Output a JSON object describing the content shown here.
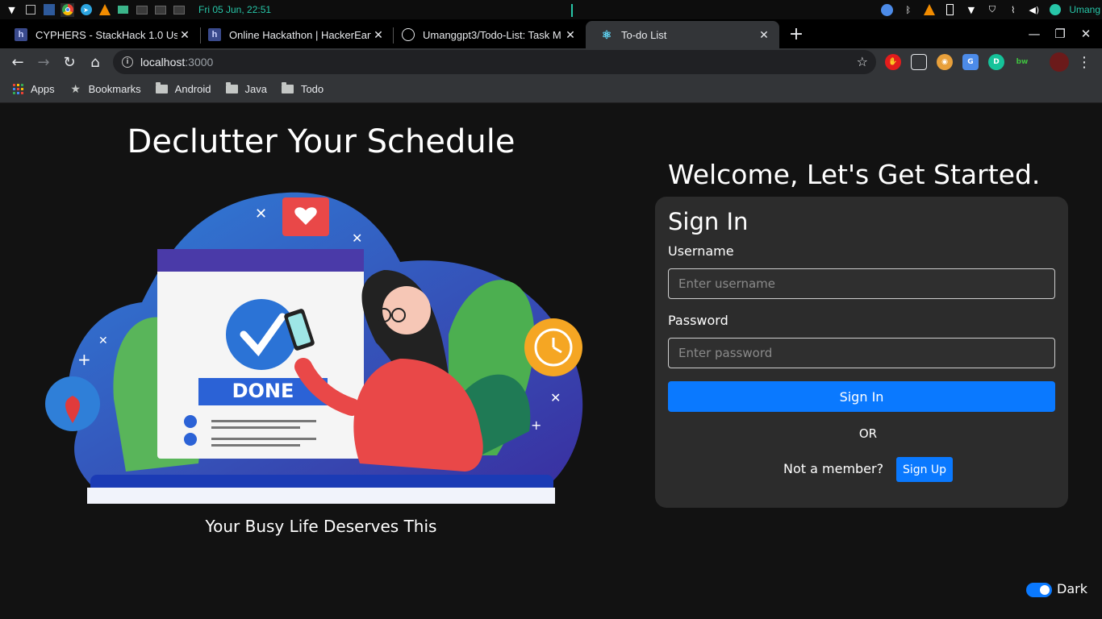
{
  "os": {
    "clock": "Fri 05 Jun, 22:51",
    "user": "Umang"
  },
  "tabs": [
    {
      "title": "CYPHERS - StackHack 1.0 User",
      "favicon": "hackerearth-icon"
    },
    {
      "title": "Online Hackathon | HackerEarth",
      "favicon": "hackerearth-icon"
    },
    {
      "title": "Umanggpt3/Todo-List: Task M",
      "favicon": "github-icon"
    },
    {
      "title": "To-do List",
      "favicon": "react-icon",
      "active": true
    }
  ],
  "address": {
    "host": "localhost",
    "port": ":3000"
  },
  "bookmarks": [
    {
      "label": "Apps",
      "icon": "apps-grid-icon"
    },
    {
      "label": "Bookmarks",
      "icon": "star-icon"
    },
    {
      "label": "Android",
      "icon": "folder-icon"
    },
    {
      "label": "Java",
      "icon": "folder-icon"
    },
    {
      "label": "Todo",
      "icon": "folder-icon"
    }
  ],
  "hero": {
    "title": "Declutter Your Schedule",
    "subtitle": "Your Busy Life Deserves This",
    "illustration_badge": "DONE"
  },
  "auth": {
    "welcome": "Welcome, Let's Get Started.",
    "card_title": "Sign In",
    "username_label": "Username",
    "username_placeholder": "Enter username",
    "password_label": "Password",
    "password_placeholder": "Enter password",
    "signin_label": "Sign In",
    "or_label": "OR",
    "not_member": "Not a member?",
    "signup_label": "Sign Up"
  },
  "theme_toggle": {
    "label": "Dark",
    "enabled": true
  },
  "colors": {
    "primary": "#0a79ff",
    "background": "#121212",
    "card": "#2c2c2c"
  }
}
